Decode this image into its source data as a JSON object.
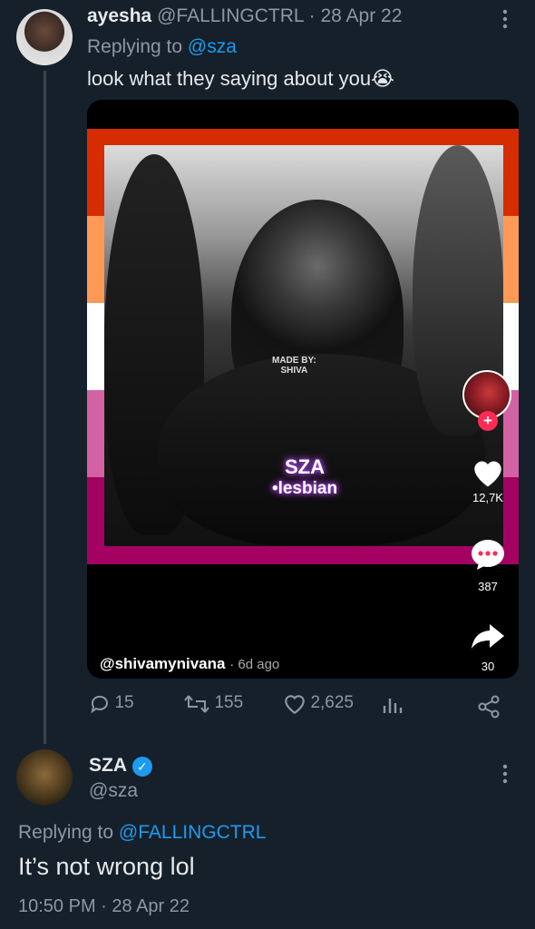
{
  "tweet1": {
    "display_name": "ayesha",
    "handle": "@FALLINGCTRL",
    "date": "· 28 Apr 22",
    "replying_prefix": "Replying to",
    "replying_to": "@sza",
    "text": "look what they saying about you😭",
    "media": {
      "watermark_line1": "MADE BY:",
      "watermark_line2": "SHIVA",
      "caption_line1": "SZA",
      "caption_line2": "•lesbian",
      "likes": "12,7K",
      "comments": "387",
      "shares": "30",
      "author": "@shivamynivana",
      "age": "· 6d ago",
      "flag_colors": [
        "#d52d00",
        "#ff9a56",
        "#ffffff",
        "#d362a4",
        "#a30262"
      ]
    },
    "stats": {
      "replies": "15",
      "retweets": "155",
      "likes": "2,625"
    }
  },
  "tweet2": {
    "display_name": "SZA",
    "handle": "@sza",
    "replying_prefix": "Replying to",
    "replying_to": "@FALLINGCTRL",
    "text": "It’s not wrong lol",
    "timestamp": "10:50 PM · 28 Apr 22"
  },
  "colors": {
    "background": "#15202b",
    "accent": "#1d9bf0",
    "muted": "#8b98a5"
  }
}
